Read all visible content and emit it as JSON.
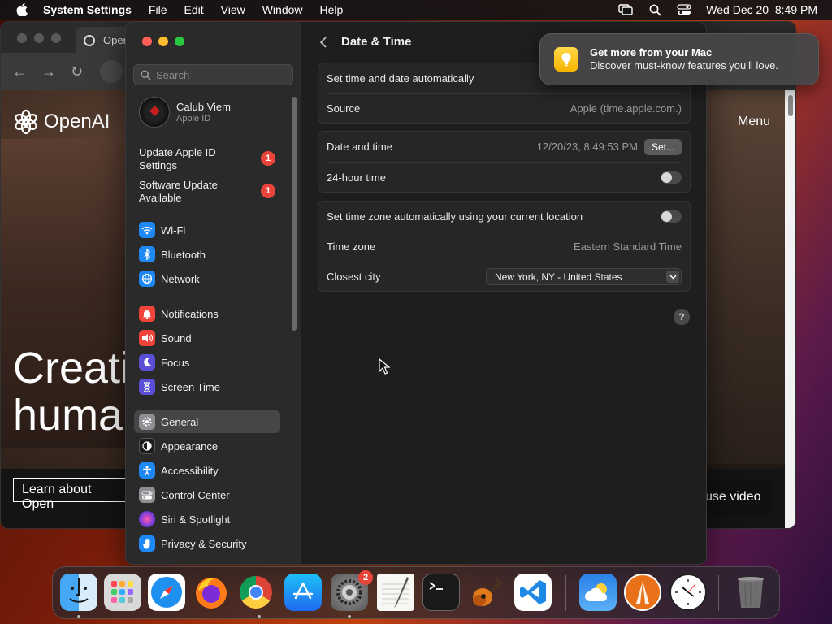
{
  "menubar": {
    "app_name": "System Settings",
    "items": [
      "File",
      "Edit",
      "View",
      "Window",
      "Help"
    ],
    "clock": "Wed Dec 20  8:49 PM"
  },
  "browser": {
    "tab_title": "Open",
    "logo_text": "OpenAI",
    "menu_label": "Menu",
    "hero_line1": "Creati",
    "hero_line2": "huma",
    "learn_button": "Learn about Open",
    "pause_button": "use video"
  },
  "sidebar": {
    "search_placeholder": "Search",
    "profile": {
      "name": "Calub Viem",
      "subtitle": "Apple ID"
    },
    "notices": [
      {
        "label": "Update Apple ID Settings",
        "badge": "1"
      },
      {
        "label": "Software Update Available",
        "badge": "1"
      }
    ],
    "items": [
      {
        "label": "Wi-Fi",
        "icon": "wifi-icon",
        "color": "#1e88f5"
      },
      {
        "label": "Bluetooth",
        "icon": "bluetooth-icon",
        "color": "#1e88f5"
      },
      {
        "label": "Network",
        "icon": "globe-icon",
        "color": "#1e88f5"
      },
      {
        "label": "Notifications",
        "icon": "bell-icon",
        "color": "#f0443a"
      },
      {
        "label": "Sound",
        "icon": "speaker-icon",
        "color": "#f0443a"
      },
      {
        "label": "Focus",
        "icon": "moon-icon",
        "color": "#5b4fd8"
      },
      {
        "label": "Screen Time",
        "icon": "hourglass-icon",
        "color": "#5b4fd8"
      },
      {
        "label": "General",
        "icon": "gear-icon",
        "color": "#8e8e93"
      },
      {
        "label": "Appearance",
        "icon": "appearance-icon",
        "color": "#1c1c1e"
      },
      {
        "label": "Accessibility",
        "icon": "accessibility-icon",
        "color": "#1e88f5"
      },
      {
        "label": "Control Center",
        "icon": "control-center-icon",
        "color": "#8e8e93"
      },
      {
        "label": "Siri & Spotlight",
        "icon": "siri-icon",
        "color": "#7a3cd8"
      },
      {
        "label": "Privacy & Security",
        "icon": "hand-icon",
        "color": "#1e88f5"
      }
    ],
    "selected": "General"
  },
  "content": {
    "title": "Date & Time",
    "group1": {
      "auto_label": "Set time and date automatically",
      "source_label": "Source",
      "source_value": "Apple (time.apple.com.)"
    },
    "group2": {
      "datetime_label": "Date and time",
      "datetime_value": "12/20/23, 8:49:53 PM",
      "set_button": "Set...",
      "hour24_label": "24-hour time"
    },
    "group3": {
      "tz_auto_label": "Set time zone automatically using your current location",
      "tz_label": "Time zone",
      "tz_value": "Eastern Standard Time",
      "city_label": "Closest city",
      "city_value": "New York, NY - United States"
    },
    "help": "?"
  },
  "notification": {
    "title": "Get more from your Mac",
    "body": "Discover must-know features you’ll love."
  },
  "dock": {
    "system_settings_badge": "2",
    "apps": [
      "Finder",
      "Launchpad",
      "Safari",
      "Firefox",
      "Chrome",
      "App Store",
      "System Settings",
      "TextEdit",
      "Terminal",
      "GarageBand",
      "Visual Studio Code",
      "Weather",
      "Alfred",
      "Clock",
      "Trash"
    ]
  },
  "colors": {
    "accent": "#1e88f5",
    "badge": "#e8443a",
    "window_bg": "#1e1e1e",
    "sidebar_bg": "#2a2a2a"
  }
}
